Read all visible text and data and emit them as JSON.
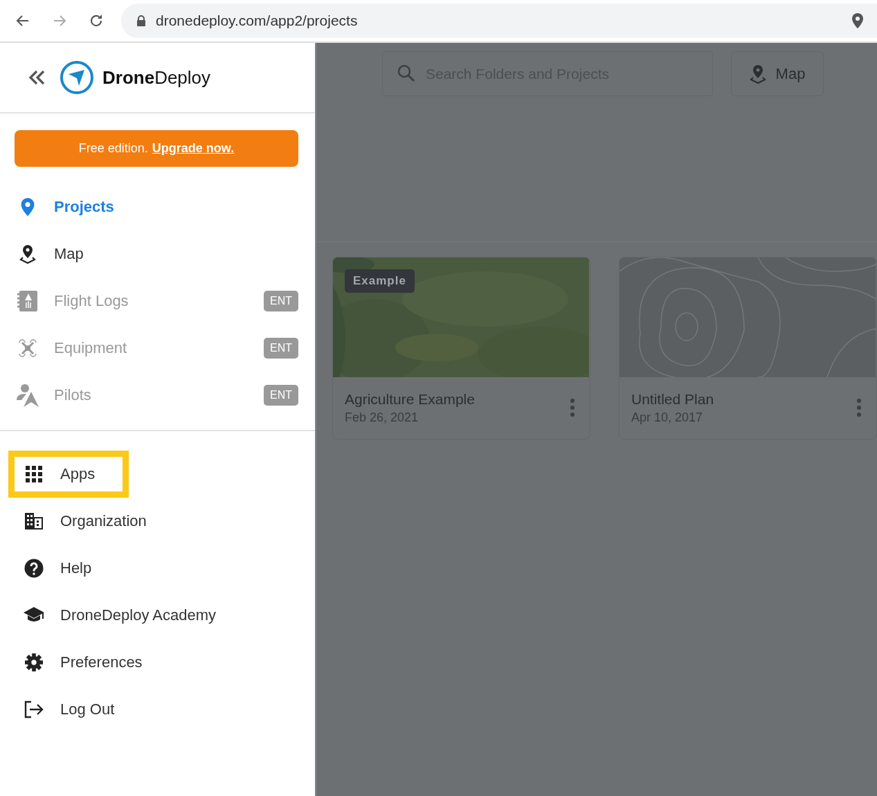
{
  "browser": {
    "url": "dronedeploy.com/app2/projects"
  },
  "sidebar": {
    "logo": "**Drone**Deploy",
    "banner": {
      "text": "Free edition.",
      "link": "Upgrade now."
    },
    "nav_items": [
      {
        "label": "Projects",
        "selected": true,
        "disabled": false
      },
      {
        "label": "Map",
        "selected": false,
        "disabled": false
      },
      {
        "label": "Flight Logs",
        "selected": false,
        "disabled": true,
        "badge": "ENT"
      },
      {
        "label": "Equipment",
        "selected": false,
        "disabled": true,
        "badge": "ENT"
      },
      {
        "label": "Pilots",
        "selected": false,
        "disabled": true,
        "badge": "ENT"
      }
    ],
    "bottom_items": [
      {
        "label": "Apps",
        "highlighted": true
      },
      {
        "label": "Organization",
        "highlighted": false
      },
      {
        "label": "Help",
        "highlighted": false
      },
      {
        "label": "DroneDeploy Academy",
        "highlighted": false
      },
      {
        "label": "Preferences",
        "highlighted": false
      },
      {
        "label": "Log Out",
        "highlighted": false
      }
    ]
  },
  "main": {
    "search": {
      "placeholder": "Search Folders and Projects"
    },
    "map_button": "Map",
    "projects": [
      {
        "title": "Agriculture Example",
        "date": "Feb 26, 2021",
        "tag": "Example"
      },
      {
        "title": "Untitled Plan",
        "date": "Apr 10, 2017",
        "kind": "contour"
      }
    ]
  }
}
